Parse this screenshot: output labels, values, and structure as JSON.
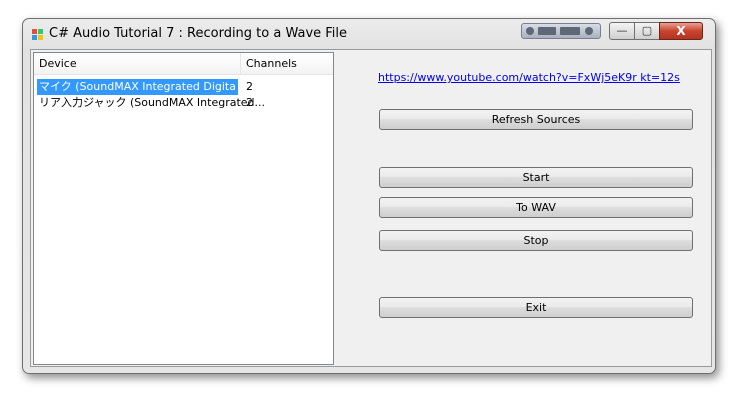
{
  "window": {
    "title": "C# Audio Tutorial 7 : Recording to a Wave File",
    "controls": {
      "minimize": "—",
      "maximize": "▢",
      "close": "X"
    }
  },
  "listview": {
    "columns": [
      "Device",
      "Channels"
    ],
    "rows": [
      {
        "device": "マイク (SoundMAX Integrated Digita",
        "channels": "2",
        "selected": true
      },
      {
        "device": "リア入力ジャック (SoundMAX Integrated...",
        "channels": "2",
        "selected": false
      }
    ]
  },
  "link": {
    "text": "https://www.youtube.com/watch?v=FxWj5eK9r kt=12s"
  },
  "buttons": {
    "refresh": "Refresh Sources",
    "start": "Start",
    "to_wav": "To WAV",
    "stop": "Stop",
    "exit": "Exit"
  },
  "colors": {
    "selection": "#3399ff",
    "link": "#0000ee",
    "close_button": "#c8442e"
  },
  "icons": {
    "app": "winforms-app-icon"
  }
}
